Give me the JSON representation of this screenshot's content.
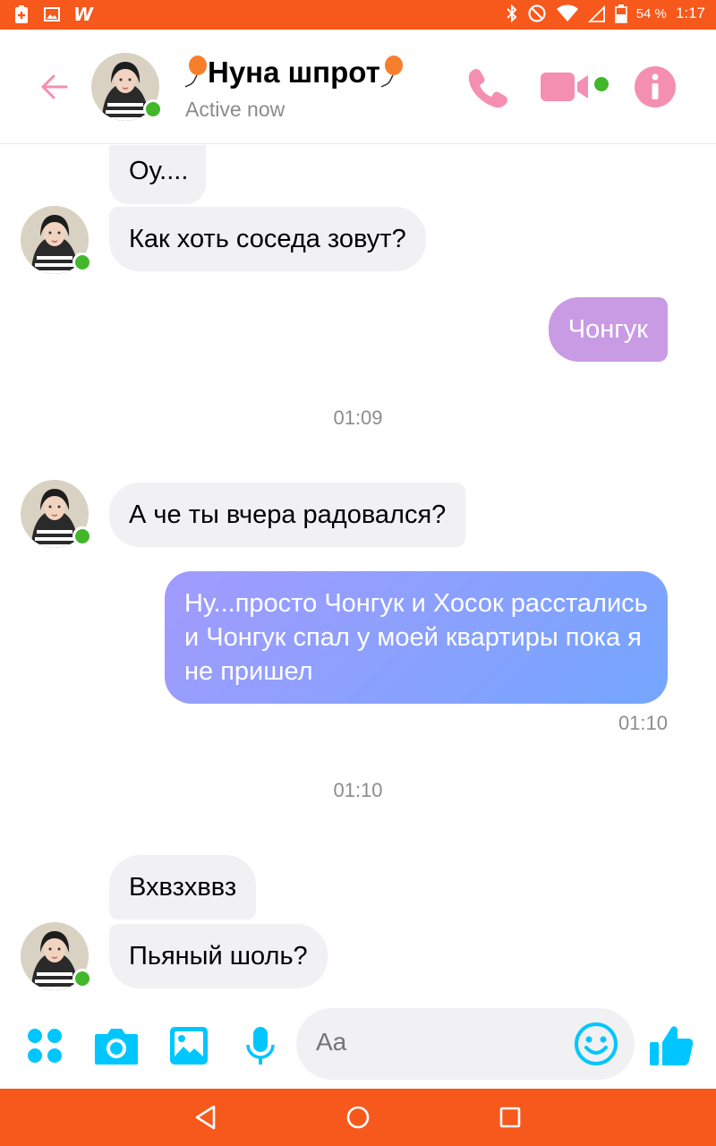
{
  "status_bar": {
    "battery": "54 %",
    "time": "1:17"
  },
  "header": {
    "contact_name": "Нуна шпрот",
    "status": "Active now"
  },
  "messages": [
    {
      "from": "them",
      "text": "Оу...."
    },
    {
      "from": "them",
      "text": "Как хоть соседа зовут?"
    },
    {
      "from": "me",
      "text": "Чонгук"
    },
    {
      "type": "timestamp",
      "text": "01:09"
    },
    {
      "from": "them",
      "text": "А че ты вчера радовался?"
    },
    {
      "from": "me",
      "text": "Ну...просто Чонгук и Хосок расстались и Чонгук спал у моей квартиры пока я не пришел",
      "sent_time": "01:10"
    },
    {
      "type": "timestamp",
      "text": "01:10"
    },
    {
      "from": "them",
      "text": "Вхвзхввз"
    },
    {
      "from": "them",
      "text": "Пьяный шоль?"
    }
  ],
  "composer": {
    "placeholder": "Aa"
  },
  "colors": {
    "status_bar": "#f7581b",
    "accent_pink": "#f48fb1",
    "bubble_in": "#f1f0f3",
    "bubble_out_purple": "#c99be4",
    "bubble_out_gradient": [
      "#a29bfe",
      "#74a6ff"
    ],
    "composer_icons": "#00c6ff",
    "online": "#42b72a"
  },
  "icons": {
    "status_bar": [
      "battery-saver-icon",
      "image-icon",
      "wattpad-icon",
      "bluetooth-icon",
      "do-not-disturb-icon",
      "wifi-icon",
      "signal-icon",
      "battery-icon"
    ],
    "header": [
      "back-arrow-icon",
      "phone-icon",
      "video-camera-icon",
      "info-icon"
    ],
    "composer": [
      "apps-icon",
      "camera-icon",
      "gallery-icon",
      "microphone-icon",
      "emoji-icon",
      "thumbs-up-icon"
    ],
    "navigation": [
      "back-triangle-icon",
      "home-circle-icon",
      "recents-square-icon"
    ]
  }
}
